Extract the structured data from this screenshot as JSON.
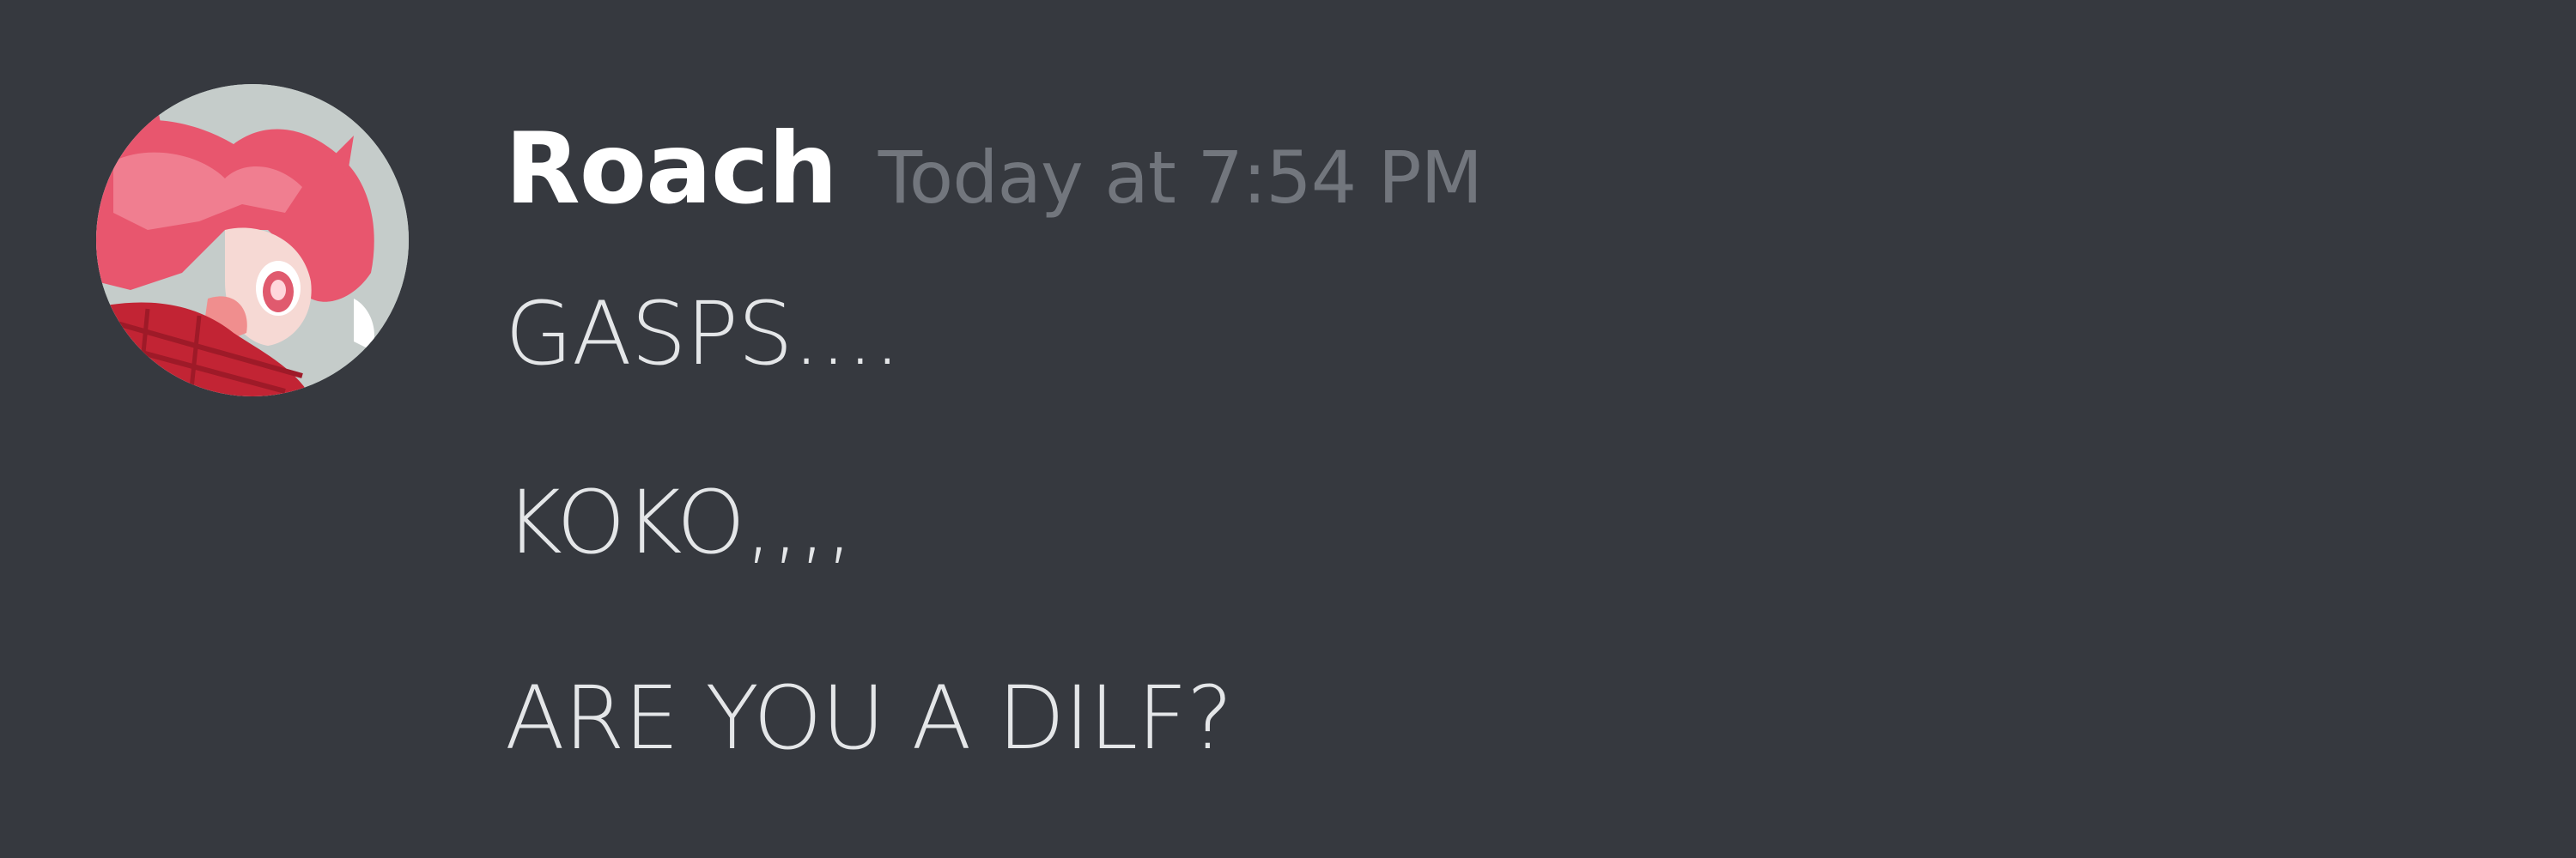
{
  "message": {
    "author": "Roach",
    "timestamp": "Today at 7:54 PM",
    "lines": [
      "GASPS....",
      "KOKO,,,,",
      "ARE YOU A DILF?"
    ]
  },
  "colors": {
    "background": "#36393f",
    "username": "#ffffff",
    "timestamp": "#72767d",
    "text": "#e4e6e8"
  }
}
